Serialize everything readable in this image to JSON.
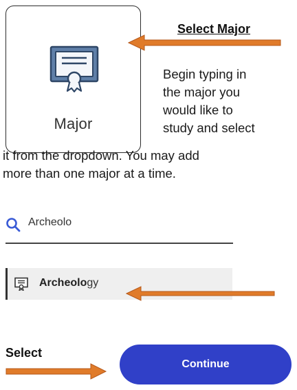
{
  "tile": {
    "label": "Major",
    "icon": "certificate-icon"
  },
  "heading": "Select Major",
  "instructions": {
    "line1": "Begin typing in",
    "line2": "the major you",
    "line3": "would like to",
    "line4": "study and select",
    "line5": "it from the dropdown. You may add",
    "line6": "more than one major at a time."
  },
  "search": {
    "value": "Archeolo",
    "icon": "search-icon"
  },
  "dropdown": {
    "option_match": "Archeolo",
    "option_rest": "gy",
    "icon": "certificate-icon"
  },
  "select_label": "Select",
  "continue_label": "Continue",
  "colors": {
    "arrow": "#e07b2a",
    "button": "#3040c8",
    "search_icon": "#3a5bd6"
  }
}
